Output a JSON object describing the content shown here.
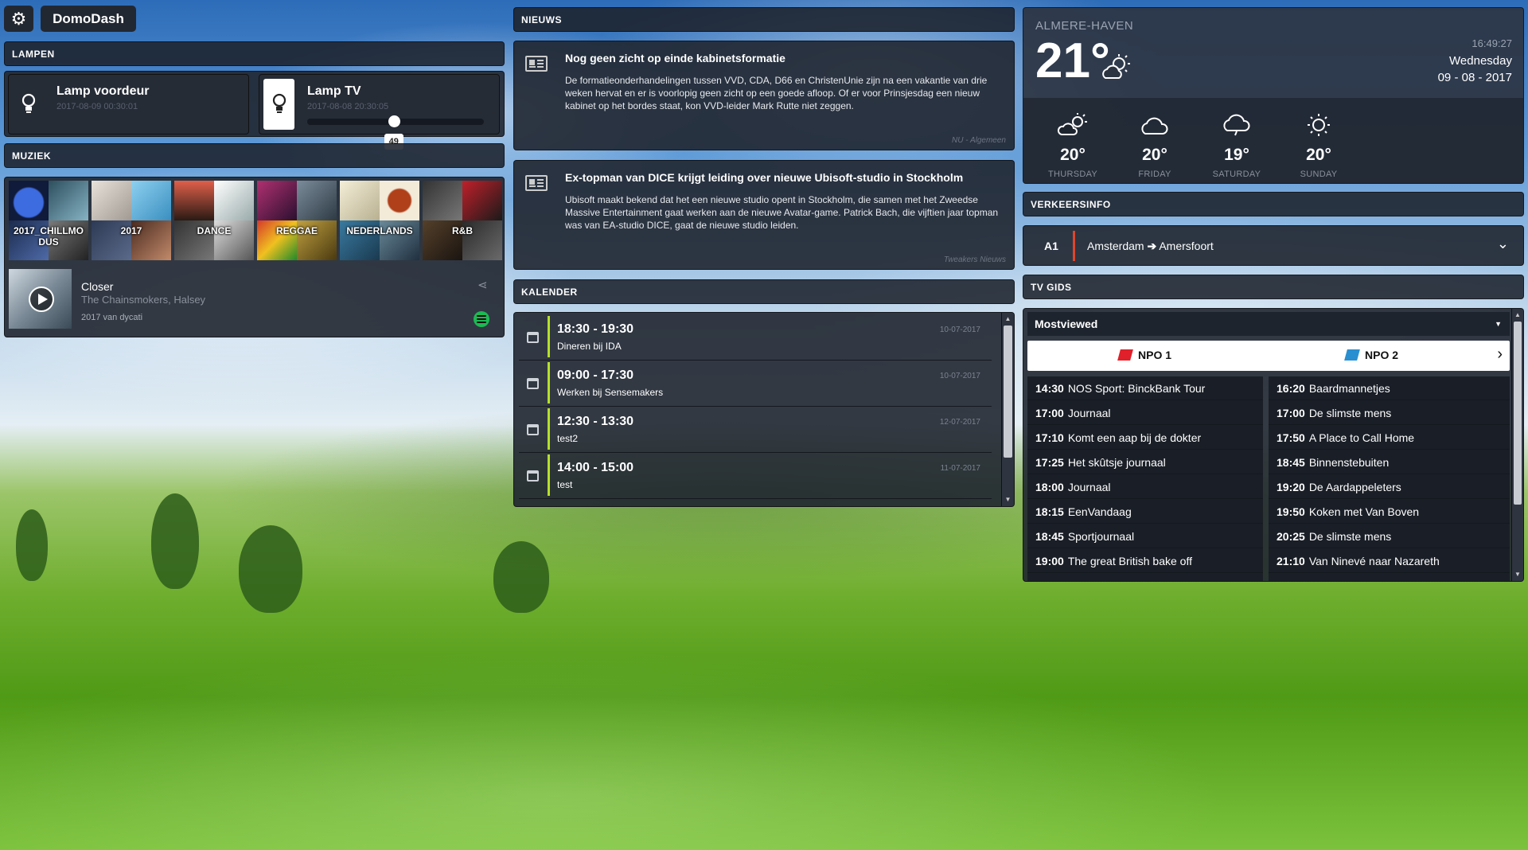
{
  "app": {
    "title": "DomoDash"
  },
  "lampen": {
    "header": "LAMPEN",
    "items": [
      {
        "name": "Lamp voordeur",
        "date": "2017-08-09 00:30:01"
      },
      {
        "name": "Lamp TV",
        "date": "2017-08-08 20:30:05",
        "dim_value": "49",
        "dim_level": 0.49
      }
    ]
  },
  "muziek": {
    "header": "MUZIEK",
    "playlists": [
      "2017_CHILLMO DUS",
      "2017",
      "DANCE",
      "REGGAE",
      "NEDERLANDS",
      "R&B"
    ],
    "now_playing": {
      "track": "Closer",
      "artist": "The Chainsmokers, Halsey",
      "playlist": "2017 van dycati"
    }
  },
  "nieuws": {
    "header": "NIEUWS",
    "items": [
      {
        "title": "Nog geen zicht op einde kabinetsformatie",
        "text": "De formatieonderhandelingen tussen VVD, CDA, D66 en ChristenUnie zijn na een vakantie van drie weken hervat en er is voorlopig geen zicht op een goede afloop. Of er voor Prinsjesdag een nieuw kabinet op het bordes staat, kon VVD-leider Mark Rutte niet zeggen.",
        "source": "NU - Algemeen"
      },
      {
        "title": "Ex-topman van DICE krijgt leiding over nieuwe Ubisoft-studio in Stockholm",
        "text": "Ubisoft maakt bekend dat het een nieuwe studio opent in Stockholm, die samen met het Zweedse Massive Entertainment gaat werken aan de nieuwe Avatar-game. Patrick Bach, die vijftien jaar topman was van EA-studio DICE, gaat de nieuwe studio leiden.",
        "source": "Tweakers Nieuws"
      }
    ]
  },
  "kalender": {
    "header": "KALENDER",
    "items": [
      {
        "time": "18:30 - 19:30",
        "desc": "Dineren bij IDA",
        "date": "10-07-2017"
      },
      {
        "time": "09:00 - 17:30",
        "desc": "Werken bij Sensemakers",
        "date": "10-07-2017"
      },
      {
        "time": "12:30 - 13:30",
        "desc": "test2",
        "date": "12-07-2017"
      },
      {
        "time": "14:00 - 15:00",
        "desc": "test",
        "date": "11-07-2017"
      }
    ]
  },
  "weer": {
    "city": "ALMERE-HAVEN",
    "temp": "21°",
    "time": "16:49:27",
    "day": "Wednesday",
    "date": "09 - 08 - 2017",
    "forecast": [
      {
        "temp": "20°",
        "day": "THURSDAY",
        "icon": "partly-sunny-icon"
      },
      {
        "temp": "20°",
        "day": "FRIDAY",
        "icon": "cloud-icon"
      },
      {
        "temp": "19°",
        "day": "SATURDAY",
        "icon": "cloud-icon"
      },
      {
        "temp": "20°",
        "day": "SUNDAY",
        "icon": "sun-icon"
      }
    ]
  },
  "verkeer": {
    "header": "VERKEERSINFO",
    "road": "A1",
    "from": "Amsterdam",
    "to": "Amersfoort"
  },
  "tvgids": {
    "header": "TV GIDS",
    "select": "Mostviewed",
    "channels": [
      "NPO 1",
      "NPO 2"
    ],
    "npo1": [
      {
        "t": "14:30",
        "p": "NOS Sport: BinckBank Tour"
      },
      {
        "t": "17:00",
        "p": "Journaal"
      },
      {
        "t": "17:10",
        "p": "Komt een aap bij de dokter"
      },
      {
        "t": "17:25",
        "p": "Het skûtsje journaal"
      },
      {
        "t": "18:00",
        "p": "Journaal"
      },
      {
        "t": "18:15",
        "p": "EenVandaag"
      },
      {
        "t": "18:45",
        "p": "Sportjournaal"
      },
      {
        "t": "19:00",
        "p": "The great British bake off"
      }
    ],
    "npo2": [
      {
        "t": "16:20",
        "p": "Baardmannetjes"
      },
      {
        "t": "17:00",
        "p": "De slimste mens"
      },
      {
        "t": "17:50",
        "p": "A Place to Call Home"
      },
      {
        "t": "18:45",
        "p": "Binnenstebuiten"
      },
      {
        "t": "19:20",
        "p": "De Aardappeleters"
      },
      {
        "t": "19:50",
        "p": "Koken met Van Boven"
      },
      {
        "t": "20:25",
        "p": "De slimste mens"
      },
      {
        "t": "21:10",
        "p": "Van Ninevé naar Nazareth"
      }
    ]
  },
  "colors": {
    "accent_green": "#b6e02a",
    "spotify": "#1db954",
    "traffic_red": "#e0452b"
  }
}
